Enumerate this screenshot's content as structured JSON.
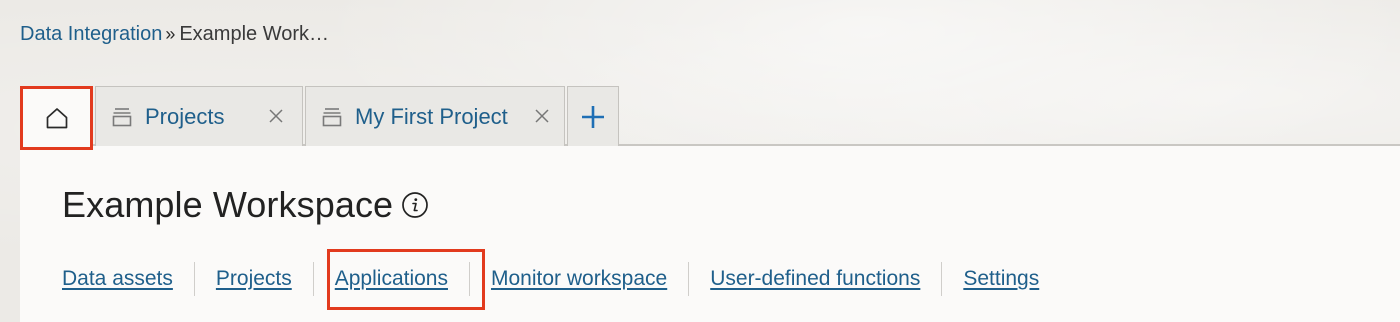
{
  "breadcrumb": {
    "root": "Data Integration",
    "separator": "»",
    "current": "Example Work…"
  },
  "tabs": [
    {
      "label": "",
      "icon": "home-icon",
      "active": true
    },
    {
      "label": "Projects",
      "icon": "stack-icon",
      "closable": true
    },
    {
      "label": "My First Project",
      "icon": "stack-icon",
      "closable": true
    },
    {
      "label": "",
      "icon": "plus-icon"
    }
  ],
  "page": {
    "title": "Example Workspace",
    "info_icon": "info-icon"
  },
  "nav": {
    "links": [
      "Data assets",
      "Projects",
      "Applications",
      "Monitor workspace",
      "User-defined functions",
      "Settings"
    ]
  },
  "colors": {
    "link": "#1f5f8b",
    "highlight": "#e23a1e",
    "text": "#222222"
  }
}
